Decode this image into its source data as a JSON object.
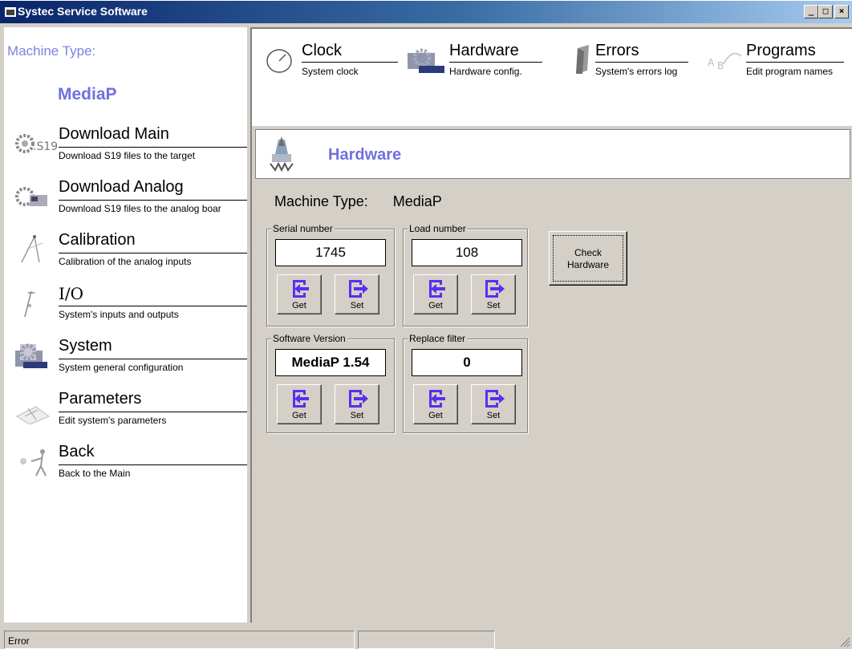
{
  "window": {
    "title": "Systec Service Software",
    "minimize_label": "_",
    "maximize_label": "□",
    "close_label": "×"
  },
  "sidebar": {
    "machine_type_label": "Machine Type:",
    "machine_type_value": "MediaP",
    "items": [
      {
        "label": "Download Main",
        "desc": "Download S19 files to the target",
        "icon": "gear-download-icon"
      },
      {
        "label": "Download Analog",
        "desc": "Download S19 files to the analog boar",
        "icon": "gear-analog-icon"
      },
      {
        "label": "Calibration",
        "desc": "Calibration of the analog inputs",
        "icon": "compass-icon"
      },
      {
        "label": "I/O",
        "desc": "System's inputs and outputs",
        "icon": "io-pin-icon"
      },
      {
        "label": "System",
        "desc": "System general configuration",
        "icon": "system-gear-icon"
      },
      {
        "label": "Parameters",
        "desc": "Edit system's parameters",
        "icon": "parameters-icon"
      },
      {
        "label": "Back",
        "desc": "Back to the Main",
        "icon": "back-figure-icon"
      }
    ]
  },
  "top_tabs": [
    {
      "label": "Clock",
      "desc": "System clock",
      "icon": "clock-icon"
    },
    {
      "label": "Hardware",
      "desc": "Hardware config.",
      "icon": "hardware-gear-icon"
    },
    {
      "label": "Errors",
      "desc": "System's errors log",
      "icon": "errors-book-icon"
    },
    {
      "label": "Programs",
      "desc": "Edit program names",
      "icon": "programs-icon"
    }
  ],
  "content": {
    "header_title": "Hardware",
    "machine_type_label": "Machine Type:",
    "machine_type_value": "MediaP",
    "groups": {
      "serial": {
        "caption": "Serial number",
        "value": "1745"
      },
      "load": {
        "caption": "Load number",
        "value": "108"
      },
      "software": {
        "caption": "Software Version",
        "value": "MediaP 1.54"
      },
      "filter": {
        "caption": "Replace filter",
        "value": "0"
      }
    },
    "get_label": "Get",
    "set_label": "Set",
    "check_hardware_label_1": "Check",
    "check_hardware_label_2": "Hardware"
  },
  "statusbar": {
    "status_text": "Error"
  },
  "colors": {
    "accent_purple": "#7070e0",
    "arrow_purple": "#5a2ef0",
    "titlebar_start": "#0a246a",
    "titlebar_end": "#a6caf0"
  }
}
